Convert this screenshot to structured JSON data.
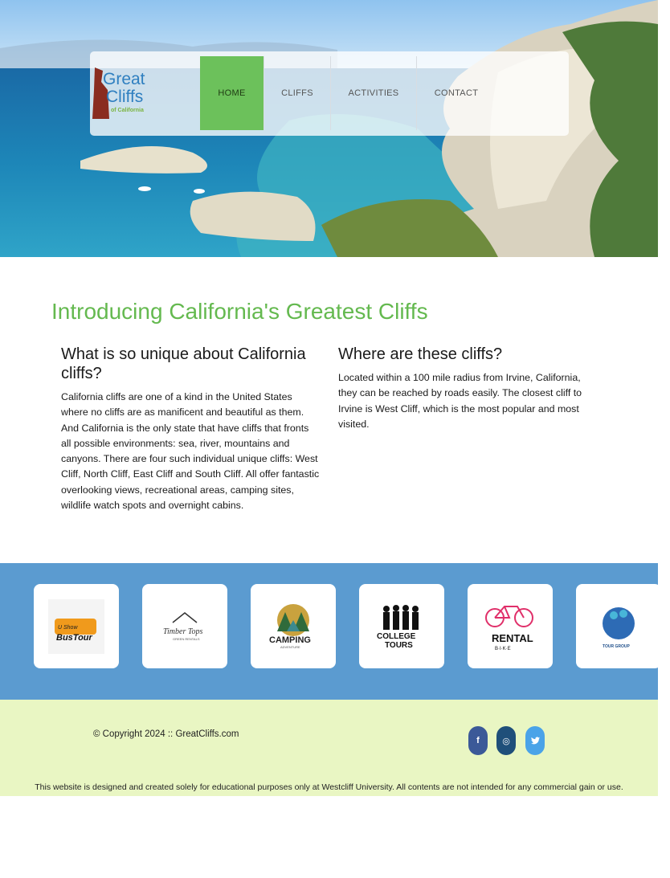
{
  "logo": {
    "line1": "Great",
    "line2": "Cliffs",
    "sub": "of California"
  },
  "nav": {
    "items": [
      {
        "label": "HOME",
        "active": true
      },
      {
        "label": "CLIFFS",
        "active": false
      },
      {
        "label": "ACTIVITIES",
        "active": false
      },
      {
        "label": "CONTACT",
        "active": false
      }
    ]
  },
  "main": {
    "title": "Introducing California's Greatest Cliffs",
    "left": {
      "heading": "What is so unique about California cliffs?",
      "body": "California cliffs are one of a kind in the United States where no cliffs are as manificent and beautiful as them. And California is the only state that have cliffs that fronts all possible environments: sea, river, mountains and canyons. There are four such individual unique cliffs: West Cliff, North Cliff, East Cliff and South Cliff. All offer fantastic overlooking views, recreational areas, camping sites, wildlife watch spots and overnight cabins."
    },
    "right": {
      "heading": "Where are these cliffs?",
      "body": "Located within a 100 mile radius from Irvine, California, they can be reached by roads easily. The closest cliff to Irvine is West Cliff, which is the most popular and most visited."
    }
  },
  "partners": {
    "logos": [
      {
        "text1": "U Show",
        "text2": "BusTour"
      },
      {
        "text1": "Timber Tops",
        "text2": "GREEN RENTALS"
      },
      {
        "text1": "CAMPING",
        "text2": "ADVENTURE"
      },
      {
        "text1": "COLLEGE",
        "text2": "TOURS"
      },
      {
        "text1": "RENTAL",
        "text2": "B·I·K·E"
      },
      {
        "text1": "TOUR GROUP",
        "text2": ""
      }
    ]
  },
  "footer": {
    "copyright": "© Copyright 2024 :: GreatCliffs.com",
    "social": [
      {
        "icon": "facebook-icon",
        "glyph": "f",
        "color": "#3b5998"
      },
      {
        "icon": "instagram-icon",
        "glyph": "◎",
        "color": "#1f4f7a"
      },
      {
        "icon": "twitter-icon",
        "glyph": "🐦",
        "color": "#4aa3e8"
      }
    ],
    "disclaimer": "This website is designed and created solely for educational purposes only at Westcliff University. All contents are not intended for any commercial gain or use."
  },
  "colors": {
    "accent_green": "#6cc15b",
    "title_green": "#64b94f",
    "partner_blue": "#5b9bd0",
    "footer_bg": "#e9f6c3"
  }
}
